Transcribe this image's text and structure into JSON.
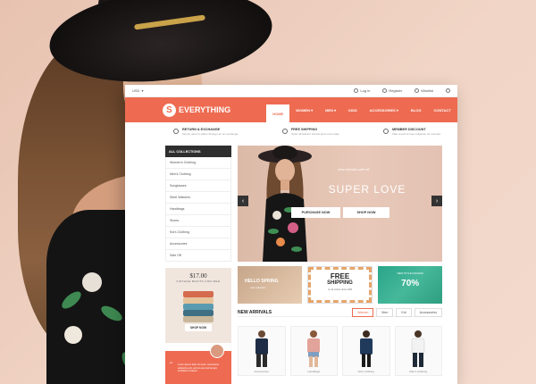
{
  "site": {
    "topbar": {
      "currency": "USD",
      "login": "Log in",
      "register": "Register",
      "wishlist": "Wishlist"
    },
    "logo": {
      "mark": "S",
      "name": "EVERYTHING"
    },
    "nav": [
      "HOME",
      "WOMEN",
      "MEN",
      "KIDS",
      "ACCESSORIES",
      "BLOG",
      "CONTACT"
    ],
    "cart_count": "0",
    "features": [
      {
        "title": "RETURN & EXCHANGE",
        "sub": "Simply return it within 30 days for an exchange."
      },
      {
        "title": "FREE SHIPPING",
        "sub": "Order all fashion brands and more today."
      },
      {
        "title": "MEMBER DISCOUNT",
        "sub": "Take a look at new collection for member."
      }
    ],
    "sidebar": {
      "heading": "ALL COLLECTIONS",
      "items": [
        "Women's Clothing",
        "Men's Clothing",
        "Sunglasses",
        "Steel Watches",
        "Handbags",
        "Shoes",
        "Kid's Clothing",
        "Accessories",
        "Sale Off"
      ]
    },
    "promo": {
      "price": "$17.00",
      "sub": "VINTAGE BOOTS FOR MEN",
      "button": "SHOP NOW"
    },
    "testimonial": {
      "quote": "“",
      "text": "Lorem ipsum dolor sit amet, consectetur adipiscing elit, sed do eiusmod tempor incididunt ut labore."
    },
    "hero": {
      "small": "new arrivals sale off",
      "title": "SUPER LOVE",
      "purchase": "PURCHASE NOW",
      "shop": "SHOP NOW",
      "prev": "‹",
      "next": "›"
    },
    "banners": {
      "spring": "HELLO SPRING",
      "spring_sub": "new collection",
      "free": "FREE",
      "shipping": "SHIPPING",
      "free_sub": "on all orders above $99",
      "fashion": "NEW STYLE FASHION",
      "percent": "70%"
    },
    "arrivals": {
      "title": "NEW ARRIVALS",
      "tabs": [
        "Women",
        "Men",
        "Kid",
        "Accessories"
      ],
      "products": [
        "Accessories",
        "Handbags",
        "Kid's Clothing",
        "Men's Clothing"
      ]
    },
    "colors": {
      "accent": "#ee6b51",
      "dark": "#2e2e2e",
      "teal": "#2aa58a"
    }
  }
}
